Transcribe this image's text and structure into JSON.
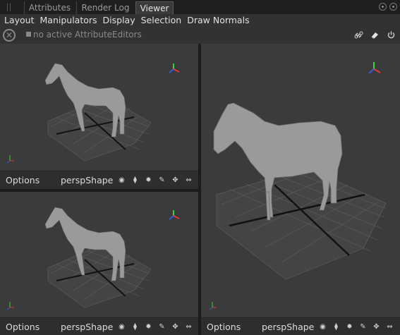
{
  "tabs": [
    {
      "label": "Attributes",
      "active": false
    },
    {
      "label": "Render Log",
      "active": false
    },
    {
      "label": "Viewer",
      "active": true
    }
  ],
  "menu": [
    "Layout",
    "Manipulators",
    "Display",
    "Selection",
    "Draw Normals"
  ],
  "infobar": {
    "text": "no active AttributeEditors"
  },
  "viewports": [
    {
      "options_label": "Options",
      "camera_label": "perspShape"
    },
    {
      "options_label": "Options",
      "camera_label": "perspShape"
    },
    {
      "options_label": "Options",
      "camera_label": "perspShape"
    }
  ],
  "icons": {
    "close": "close-circle-icon",
    "link": "link-icon",
    "eraser": "eraser-icon",
    "power": "power-icon",
    "eye": "eye-icon",
    "pin": "pin-icon",
    "gear": "gear-icon",
    "pencil": "pencil-icon",
    "move": "move-icon",
    "arrows": "left-right-arrows-icon"
  },
  "colors": {
    "viewport_bg": "#3b3b3b",
    "axis_x": "#e03a3a",
    "axis_y": "#3ad43a",
    "axis_z": "#3a5be0"
  }
}
